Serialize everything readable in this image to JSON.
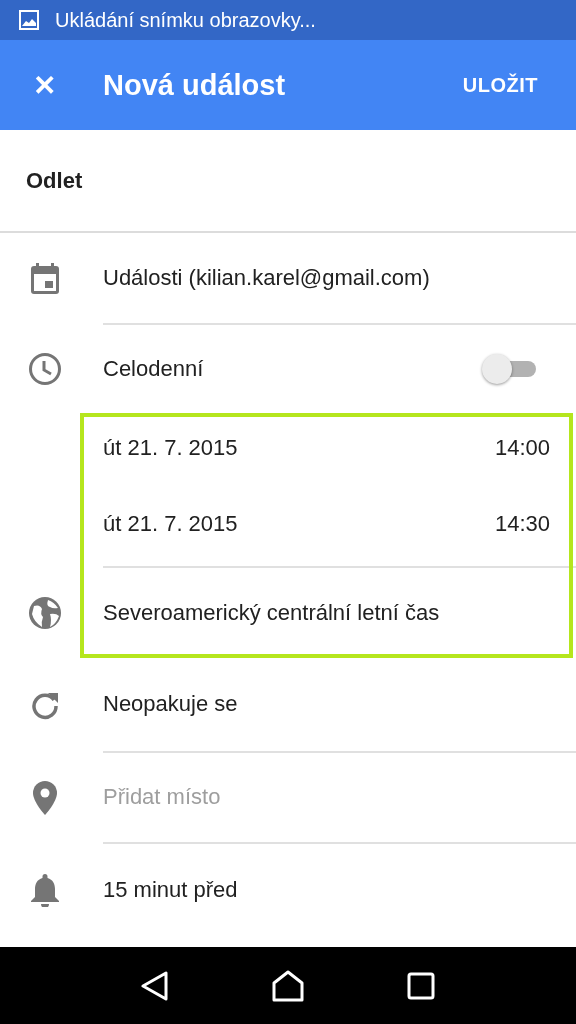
{
  "status_bar": {
    "text": "Ukládání snímku obrazovky..."
  },
  "app_bar": {
    "close": "✕",
    "title": "Nová událost",
    "action": "ULOŽIT"
  },
  "event_title": {
    "value": "Odlet"
  },
  "rows": [
    {
      "kind": "calendar",
      "text": "Události (kilian.karel@gmail.com)"
    },
    {
      "kind": "allday",
      "text": "Celodenní",
      "on": false
    },
    {
      "kind": "datetime",
      "date": "út 21. 7. 2015",
      "time": "14:00"
    },
    {
      "kind": "datetime",
      "date": "út 21. 7. 2015",
      "time": "14:30"
    },
    {
      "kind": "timezone",
      "text": "Severoamerický centrální letní čas"
    },
    {
      "kind": "repeat",
      "text": "Neopakuje se"
    },
    {
      "kind": "place",
      "placeholder": "Přidat místo"
    },
    {
      "kind": "reminder",
      "text": "15 minut před"
    }
  ]
}
